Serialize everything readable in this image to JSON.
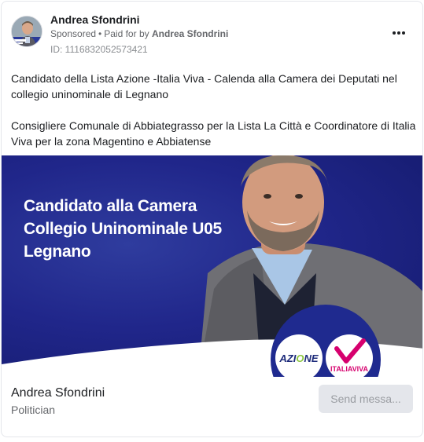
{
  "ad": {
    "page_name": "Andrea Sfondrini",
    "sponsored_label": "Sponsored",
    "separator": "•",
    "paid_for_prefix": "Paid for by",
    "paid_for_by": "Andrea Sfondrini",
    "ad_id": "ID: 1116832052573421",
    "more_icon": "more-horizontal-icon"
  },
  "body": {
    "paragraph_1": "Candidato della Lista Azione -Italia Viva - Calenda alla Camera dei Deputati nel collegio uninominale di Legnano",
    "paragraph_2": "Consigliere Comunale di Abbiategrasso per la Lista La Città e Coordinatore di Italia Viva per la zona Magentino e Abbiatense"
  },
  "creative": {
    "headline_lines": [
      "Candidato alla Camera",
      "Collegio Uninominale U05",
      "Legnano"
    ],
    "logo_left": "AZIONE",
    "logo_right": "ITALIAVIVA",
    "colors": {
      "background": "#20268a",
      "azione_blue": "#1c2a7a",
      "azione_accent": "#8cc63f",
      "italiaviva_pink": "#d6006e"
    }
  },
  "footer": {
    "name": "Andrea Sfondrini",
    "category": "Politician",
    "cta_label": "Send messa..."
  }
}
